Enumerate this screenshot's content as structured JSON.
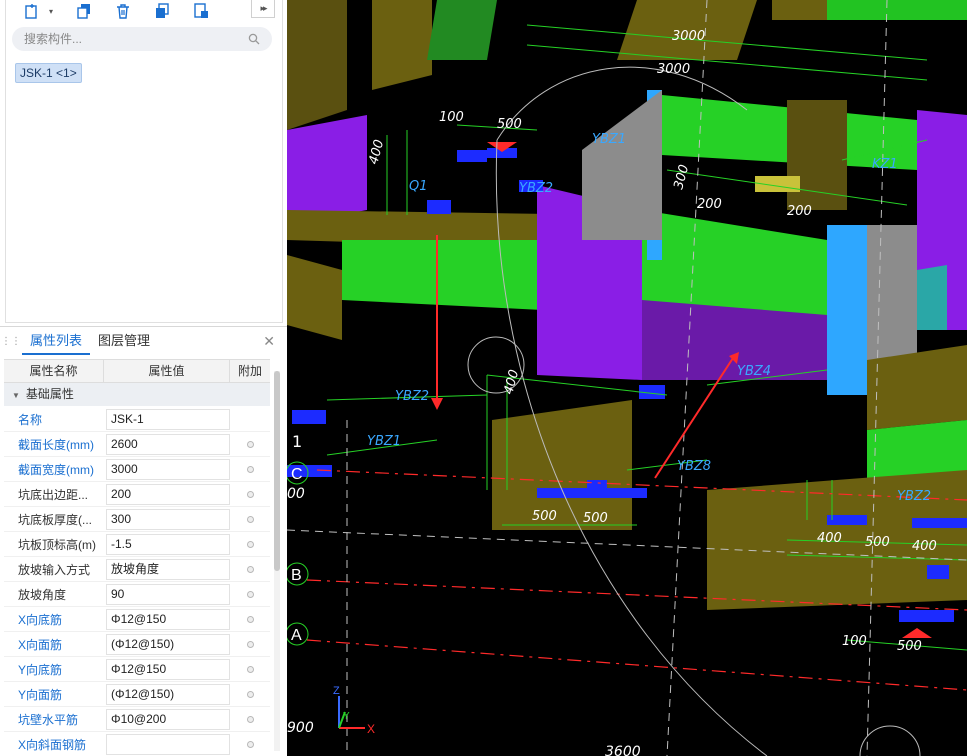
{
  "search": {
    "placeholder": "搜索构件..."
  },
  "component_tag": "JSK-1 <1>",
  "props_panel": {
    "tabs": [
      {
        "label": "属性列表"
      },
      {
        "label": "图层管理"
      }
    ],
    "columns": {
      "name": "属性名称",
      "value": "属性值",
      "extra": "附加"
    },
    "group": "基础属性",
    "rows": [
      {
        "name": "名称",
        "value": "JSK-1",
        "blue": true,
        "extra": false
      },
      {
        "name": "截面长度(mm)",
        "value": "2600",
        "blue": true,
        "extra": true
      },
      {
        "name": "截面宽度(mm)",
        "value": "3000",
        "blue": true,
        "extra": true
      },
      {
        "name": "坑底出边距...",
        "value": "200",
        "blue": false,
        "extra": true
      },
      {
        "name": "坑底板厚度(...",
        "value": "300",
        "blue": false,
        "extra": true
      },
      {
        "name": "坑板顶标高(m)",
        "value": "-1.5",
        "blue": false,
        "extra": true
      },
      {
        "name": "放坡输入方式",
        "value": "放坡角度",
        "blue": false,
        "extra": true
      },
      {
        "name": "放坡角度",
        "value": "90",
        "blue": false,
        "extra": true
      },
      {
        "name": "X向底筋",
        "value": "Φ12@150",
        "blue": true,
        "extra": true
      },
      {
        "name": "X向面筋",
        "value": "(Φ12@150)",
        "blue": true,
        "extra": true
      },
      {
        "name": "Y向底筋",
        "value": "Φ12@150",
        "blue": true,
        "extra": true
      },
      {
        "name": "Y向面筋",
        "value": "(Φ12@150)",
        "blue": true,
        "extra": true
      },
      {
        "name": "坑壁水平筋",
        "value": "Φ10@200",
        "blue": true,
        "extra": true
      },
      {
        "name": "X向斜面钢筋",
        "value": "",
        "blue": true,
        "extra": true
      }
    ]
  },
  "viewport": {
    "dim_labels": [
      "3000",
      "3000",
      "100",
      "500",
      "200",
      "200",
      "500",
      "500",
      "400",
      "500",
      "400",
      "100",
      "500",
      "400",
      "400",
      "300",
      "1",
      "00",
      "900",
      "3600"
    ],
    "element_labels": [
      "YBZ1",
      "YBZ2",
      "Q1",
      "KZ1",
      "YBZ4",
      "YBZ2",
      "YBZ1",
      "YBZ8",
      "YBZ2"
    ],
    "axis_labels": [
      "B",
      "A",
      "C"
    ],
    "triad": {
      "z": "Z",
      "y": "Y",
      "x": "X"
    }
  },
  "colors": {
    "accent": "#1a6fd0",
    "viewport_bg": "#000000",
    "purple": "#8a1ee6",
    "green": "#26d126",
    "olive": "#6b6010",
    "blue": "#1c2bff",
    "cyan": "#2ea7ff",
    "gray": "#8c8c8c",
    "red": "#ff2a2a"
  }
}
